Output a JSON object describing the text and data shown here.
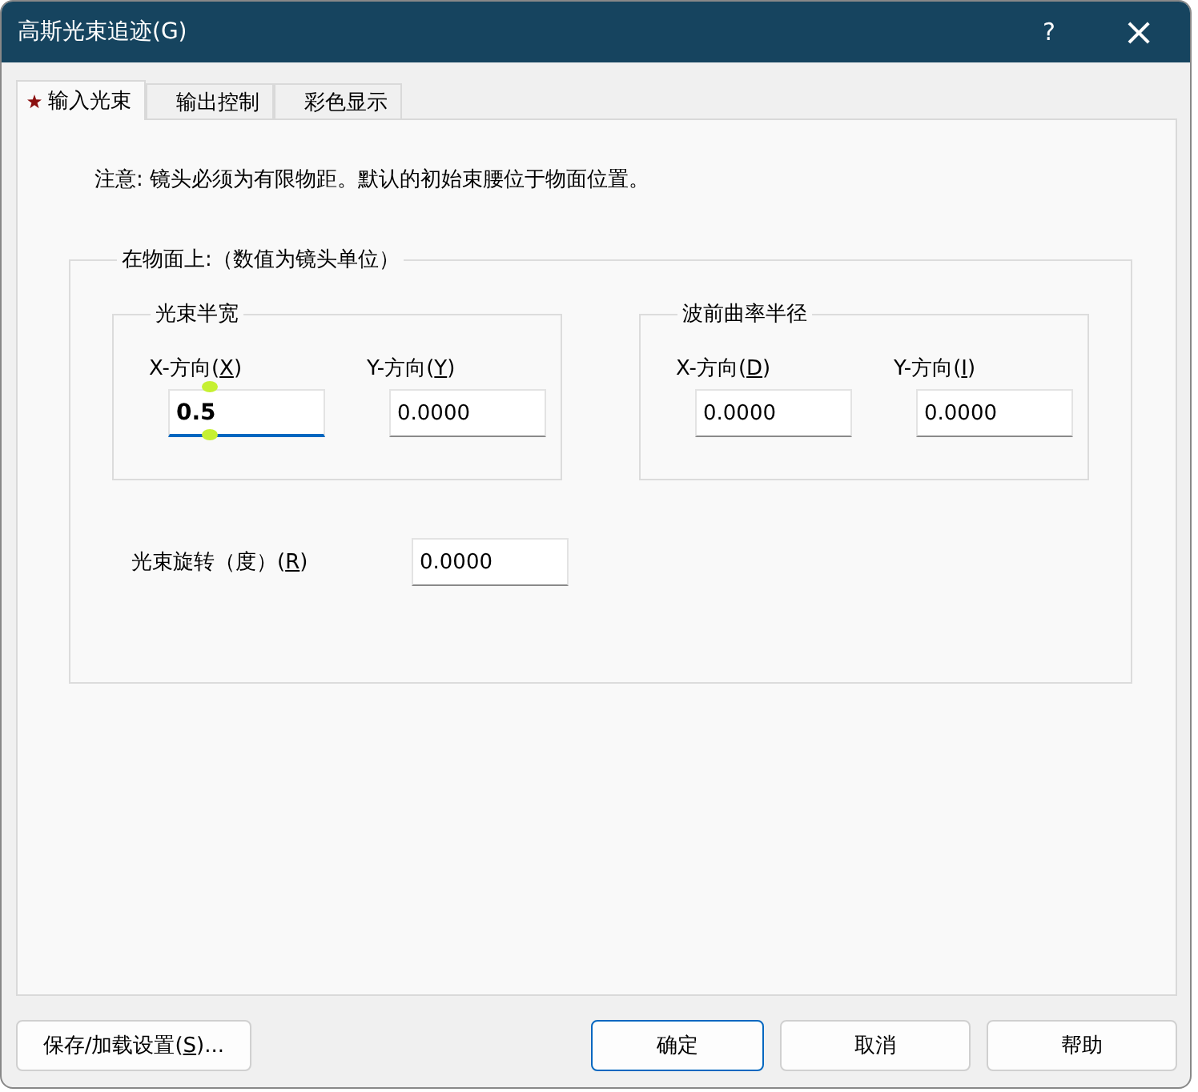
{
  "window": {
    "title": "高斯光束追迹(G)",
    "help": "?",
    "close": "×"
  },
  "tabs": [
    {
      "label": "输入光束",
      "selected": true,
      "marked": true
    },
    {
      "label": "输出控制",
      "selected": false,
      "marked": false
    },
    {
      "label": "彩色显示",
      "selected": false,
      "marked": false
    }
  ],
  "note": "注意: 镜头必须为有限物距。默认的初始束腰位于物面位置。",
  "object_group": {
    "title": "在物面上:（数值为镜头单位）",
    "groups": [
      {
        "title": "光束半宽",
        "fields": [
          {
            "before": "X-方向(",
            "key": "X",
            "after": ")",
            "value": "0.5",
            "focused": true
          },
          {
            "before": "Y-方向(",
            "key": "Y",
            "after": ")",
            "value": "0.0000",
            "focused": false
          }
        ]
      },
      {
        "title": "波前曲率半径",
        "fields": [
          {
            "before": "X-方向(",
            "key": "D",
            "after": ")",
            "value": "0.0000",
            "focused": false
          },
          {
            "before": "Y-方向(",
            "key": "I",
            "after": ")",
            "value": "0.0000",
            "focused": false
          }
        ]
      }
    ],
    "rotation": {
      "before": "光束旋转（度）(",
      "key": "R",
      "after": ")",
      "value": "0.0000"
    }
  },
  "buttons": [
    {
      "before": "保存/加载设置(",
      "key": "S",
      "after": ")...",
      "default": false
    },
    {
      "before": "确定",
      "default": true
    },
    {
      "before": "取消",
      "default": false
    },
    {
      "before": "帮助",
      "default": false
    }
  ]
}
